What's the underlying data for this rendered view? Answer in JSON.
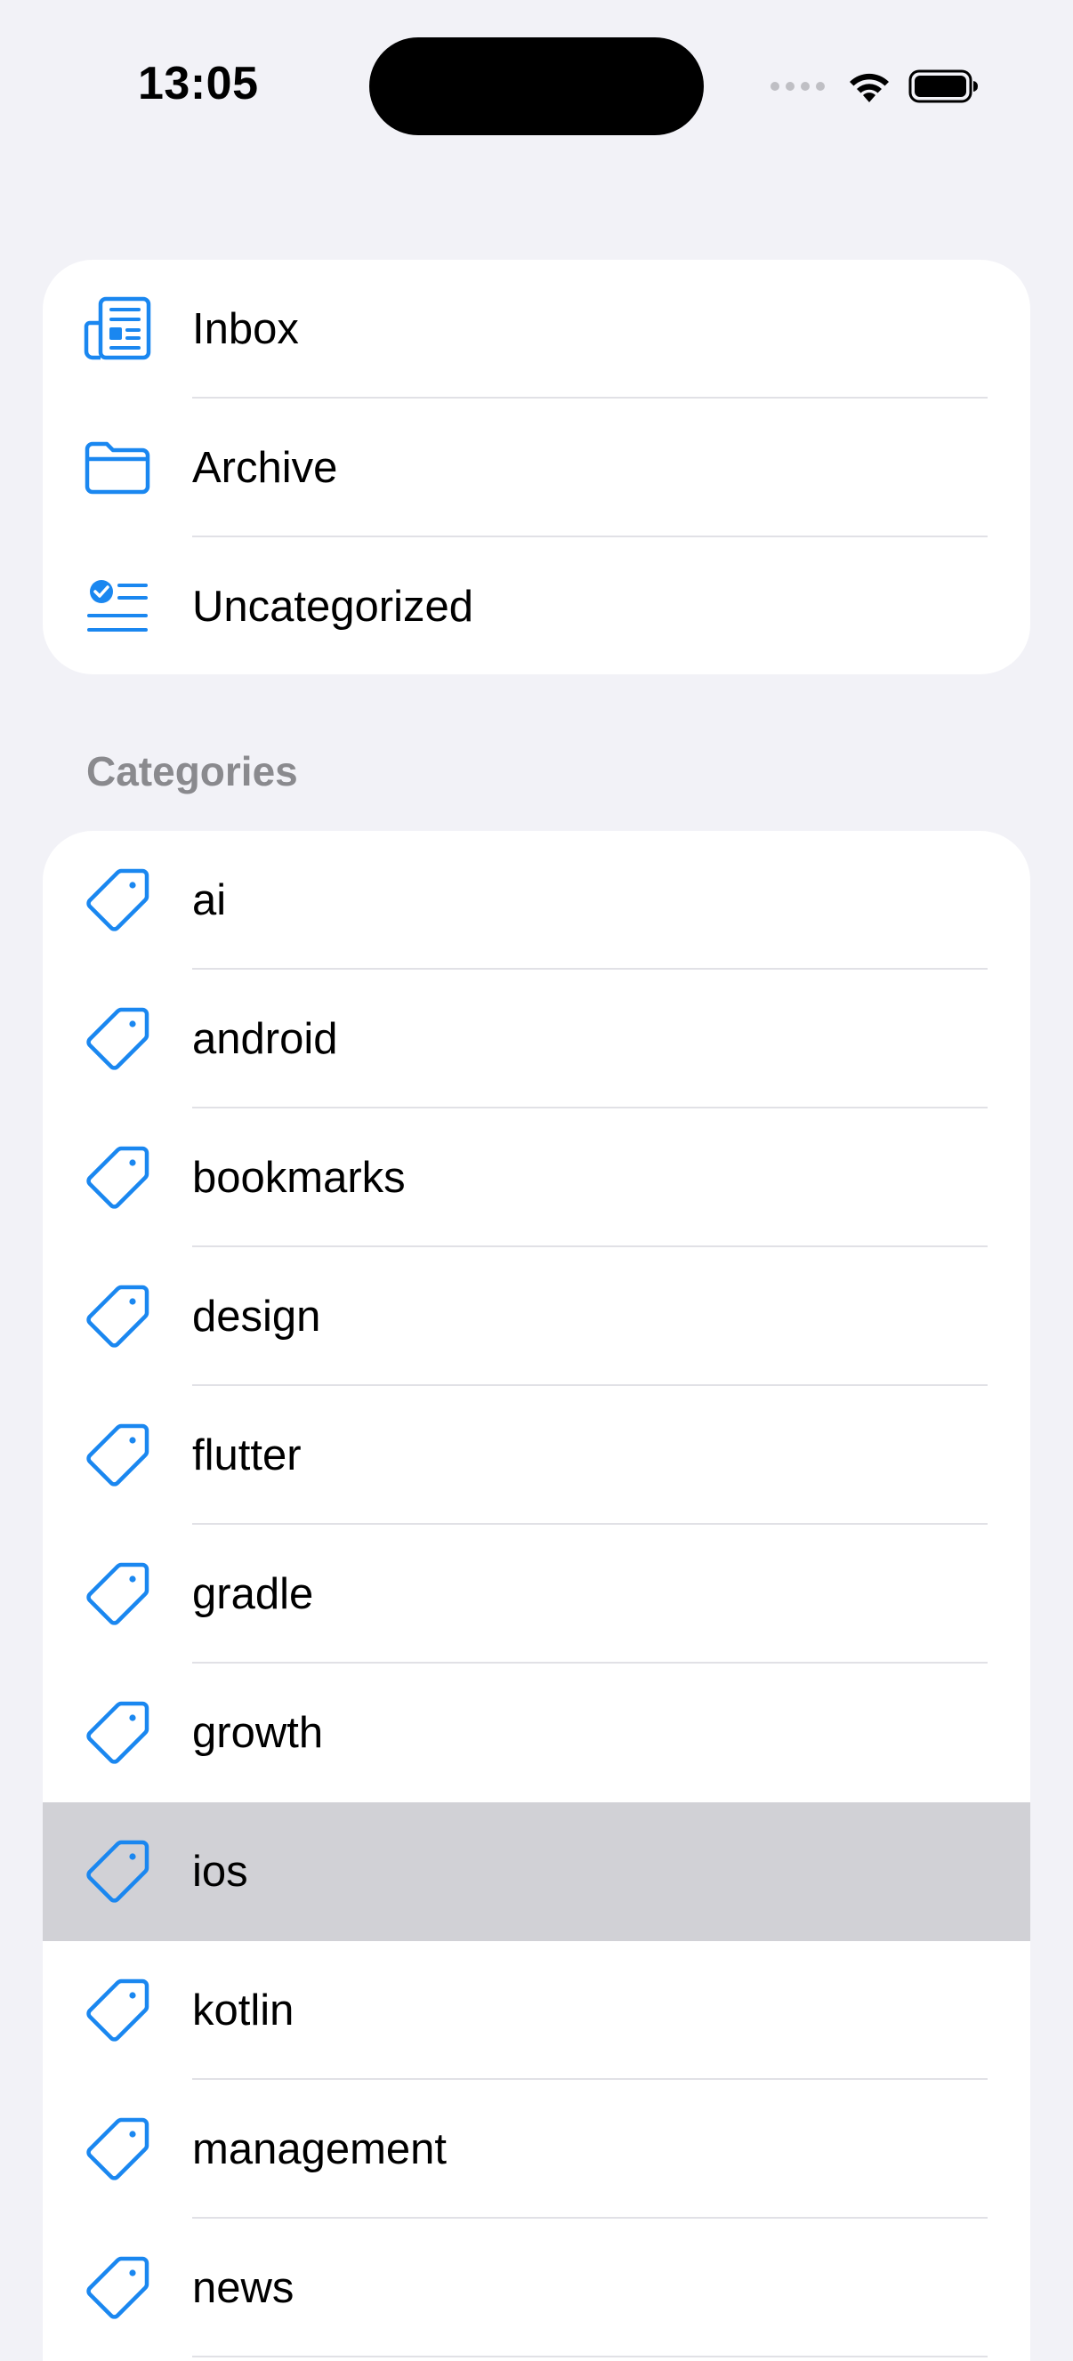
{
  "status_bar": {
    "time": "13:05"
  },
  "colors": {
    "accent": "#1A87F0",
    "background": "#F2F2F7",
    "selected_row": "#D1D1D6"
  },
  "top_list": {
    "items": [
      {
        "label": "Inbox",
        "icon": "newspaper-icon"
      },
      {
        "label": "Archive",
        "icon": "folder-icon"
      },
      {
        "label": "Uncategorized",
        "icon": "checklist-icon"
      }
    ]
  },
  "categories": {
    "header": "Categories",
    "selected": "ios",
    "items": [
      {
        "label": "ai",
        "icon": "tag-icon"
      },
      {
        "label": "android",
        "icon": "tag-icon"
      },
      {
        "label": "bookmarks",
        "icon": "tag-icon"
      },
      {
        "label": "design",
        "icon": "tag-icon"
      },
      {
        "label": "flutter",
        "icon": "tag-icon"
      },
      {
        "label": "gradle",
        "icon": "tag-icon"
      },
      {
        "label": "growth",
        "icon": "tag-icon"
      },
      {
        "label": "ios",
        "icon": "tag-icon"
      },
      {
        "label": "kotlin",
        "icon": "tag-icon"
      },
      {
        "label": "management",
        "icon": "tag-icon"
      },
      {
        "label": "news",
        "icon": "tag-icon"
      }
    ]
  }
}
